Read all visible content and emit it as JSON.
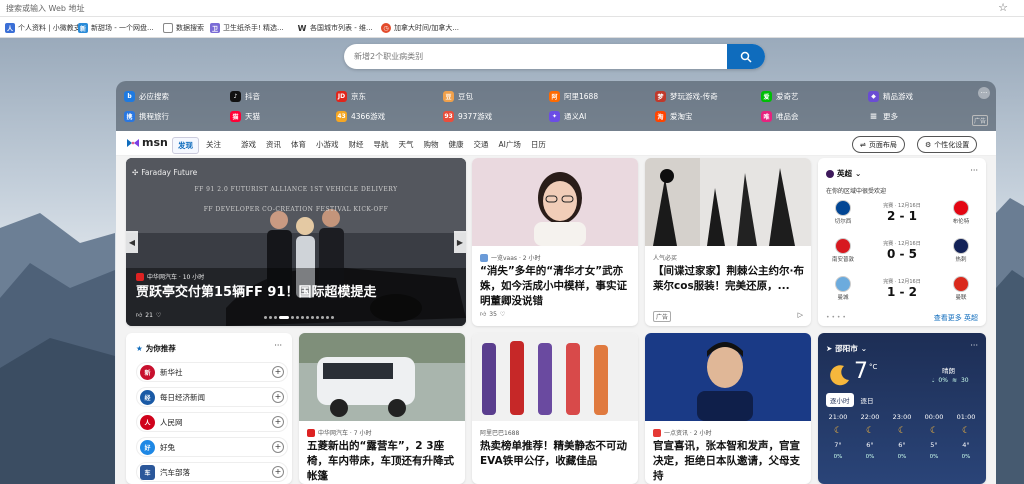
{
  "address_bar": {
    "placeholder": "搜索或输入 Web 地址"
  },
  "bookmarks": [
    {
      "label": "个人资料 | 小微教支...",
      "icon": "user-icon",
      "color": "#3b6fd6"
    },
    {
      "label": "新甜场 - 一个网盘...",
      "icon": "globe-icon",
      "color": "#2a8bd8"
    },
    {
      "label": "数据搜索",
      "icon": "page-icon",
      "color": "#777777"
    },
    {
      "label": "卫生纸杀手! 精选...",
      "icon": "box-icon",
      "color": "#7a6cd6"
    },
    {
      "label": "各国城市列表 - 维...",
      "icon": "wiki-icon",
      "color": "#444444"
    },
    {
      "label": "加拿大时间/加拿大...",
      "icon": "clock-icon",
      "color": "#e34b2b"
    }
  ],
  "search": {
    "placeholder": "新增2个职业病类别"
  },
  "quick_links": [
    {
      "label": "必应搜索",
      "color": "#1f7ae0"
    },
    {
      "label": "抖音",
      "color": "#111111"
    },
    {
      "label": "京东",
      "color": "#e1251b"
    },
    {
      "label": "豆包",
      "color": "#f0a04b"
    },
    {
      "label": "阿里1688",
      "color": "#ff6a00"
    },
    {
      "label": "梦玩游戏-传奇",
      "color": "#c0392b"
    },
    {
      "label": "爱奇艺",
      "color": "#00be06"
    },
    {
      "label": "精品游戏",
      "color": "#6a4cd4"
    },
    {
      "label": "携程旅行",
      "color": "#2a77e0"
    },
    {
      "label": "天猫",
      "color": "#ff0036"
    },
    {
      "label": "4366游戏",
      "color": "#f5a623"
    },
    {
      "label": "9377游戏",
      "color": "#e94e3c"
    },
    {
      "label": "通义AI",
      "color": "#6b4de6"
    },
    {
      "label": "爱淘宝",
      "color": "#ff4400"
    },
    {
      "label": "唯品会",
      "color": "#e6237f"
    },
    {
      "label": "更多",
      "color": "#cccccc"
    }
  ],
  "quick_ad": "广告",
  "msn": {
    "logo": "msn",
    "tabs": [
      "发现",
      "关注"
    ],
    "categories": [
      "游戏",
      "资讯",
      "体育",
      "小游戏",
      "财经",
      "导航",
      "天气",
      "购物",
      "健康",
      "交通",
      "AI广场",
      "日历"
    ],
    "layout_btn": "页面布局",
    "personalize_btn": "个性化设置"
  },
  "hero": {
    "brand": "Faraday Future",
    "banner1": "FF 91 2.0 FUTURIST ALLIANCE 1ST VEHICLE DELIVERY",
    "banner2": "FF DEVELOPER CO-CREATION FESTIVAL KICK-OFF",
    "source": "中华网汽车 · 10 小时",
    "title": "贾跃亭交付第15辆FF 91！国际超模提走",
    "likes": "21"
  },
  "news1": {
    "source": "一览vaas · 2 小时",
    "title": "“消失”多年的“清华才女”武亦姝，如今活成小中模样，事实证明董卿没说错",
    "likes": "35"
  },
  "ad1": {
    "source": "人气必买",
    "title": "【间谍过家家】荆棘公主约尔·布莱尔cos服装！完美还原，...",
    "ad_label": "广告"
  },
  "sports": {
    "league": "英超",
    "subtitle": "在你的区域中很受欢迎",
    "matches": [
      {
        "home": "切尔西",
        "away": "布伦特",
        "time": "完赛 · 12月16日",
        "score": "2 - 1",
        "hc": "#034694",
        "ac": "#e30613"
      },
      {
        "home": "南安普敦",
        "away": "热刺",
        "time": "完赛 · 12月16日",
        "score": "0 - 5",
        "hc": "#d71920",
        "ac": "#132257"
      },
      {
        "home": "曼城",
        "away": "曼联",
        "time": "完赛 · 12月16日",
        "score": "1 - 2",
        "hc": "#6cabdd",
        "ac": "#da291c"
      }
    ],
    "more": "查看更多 英超"
  },
  "recommend": {
    "title": "为你推荐",
    "items": [
      {
        "name": "新华社",
        "color": "#c8102e"
      },
      {
        "name": "每日经济新闻",
        "color": "#1a5aa6"
      },
      {
        "name": "人民网",
        "color": "#d0021b"
      },
      {
        "name": "好兔",
        "color": "#1e88e5"
      },
      {
        "name": "汽车部落",
        "color": "#2b579a"
      }
    ]
  },
  "news2": {
    "source": "中华网汽车 · 7 小时",
    "title": "五菱新出的“露营车”，2 3座椅，车内带床，车顶还有升降式帐篷"
  },
  "news3": {
    "source": "阿里巴巴1688",
    "title": "热卖榜单推荐！精美静态不可动EVA铁甲公仔，收藏佳品"
  },
  "news4": {
    "source": "一点资讯 · 2 小时",
    "title": "官宣喜讯，张本智和发声，官宣决定，拒绝日本队邀请，父母支持"
  },
  "weather": {
    "city": "邵阳市",
    "temp": "7",
    "unit": "°C",
    "cond": "晴朗",
    "precip": "0%",
    "low": "30",
    "tabs": [
      "逐小时",
      "逐日"
    ],
    "hours": [
      "21:00",
      "22:00",
      "23:00",
      "00:00",
      "01:00"
    ],
    "temps": [
      "7°",
      "6°",
      "6°",
      "5°",
      "4°"
    ],
    "rain": "0%"
  }
}
